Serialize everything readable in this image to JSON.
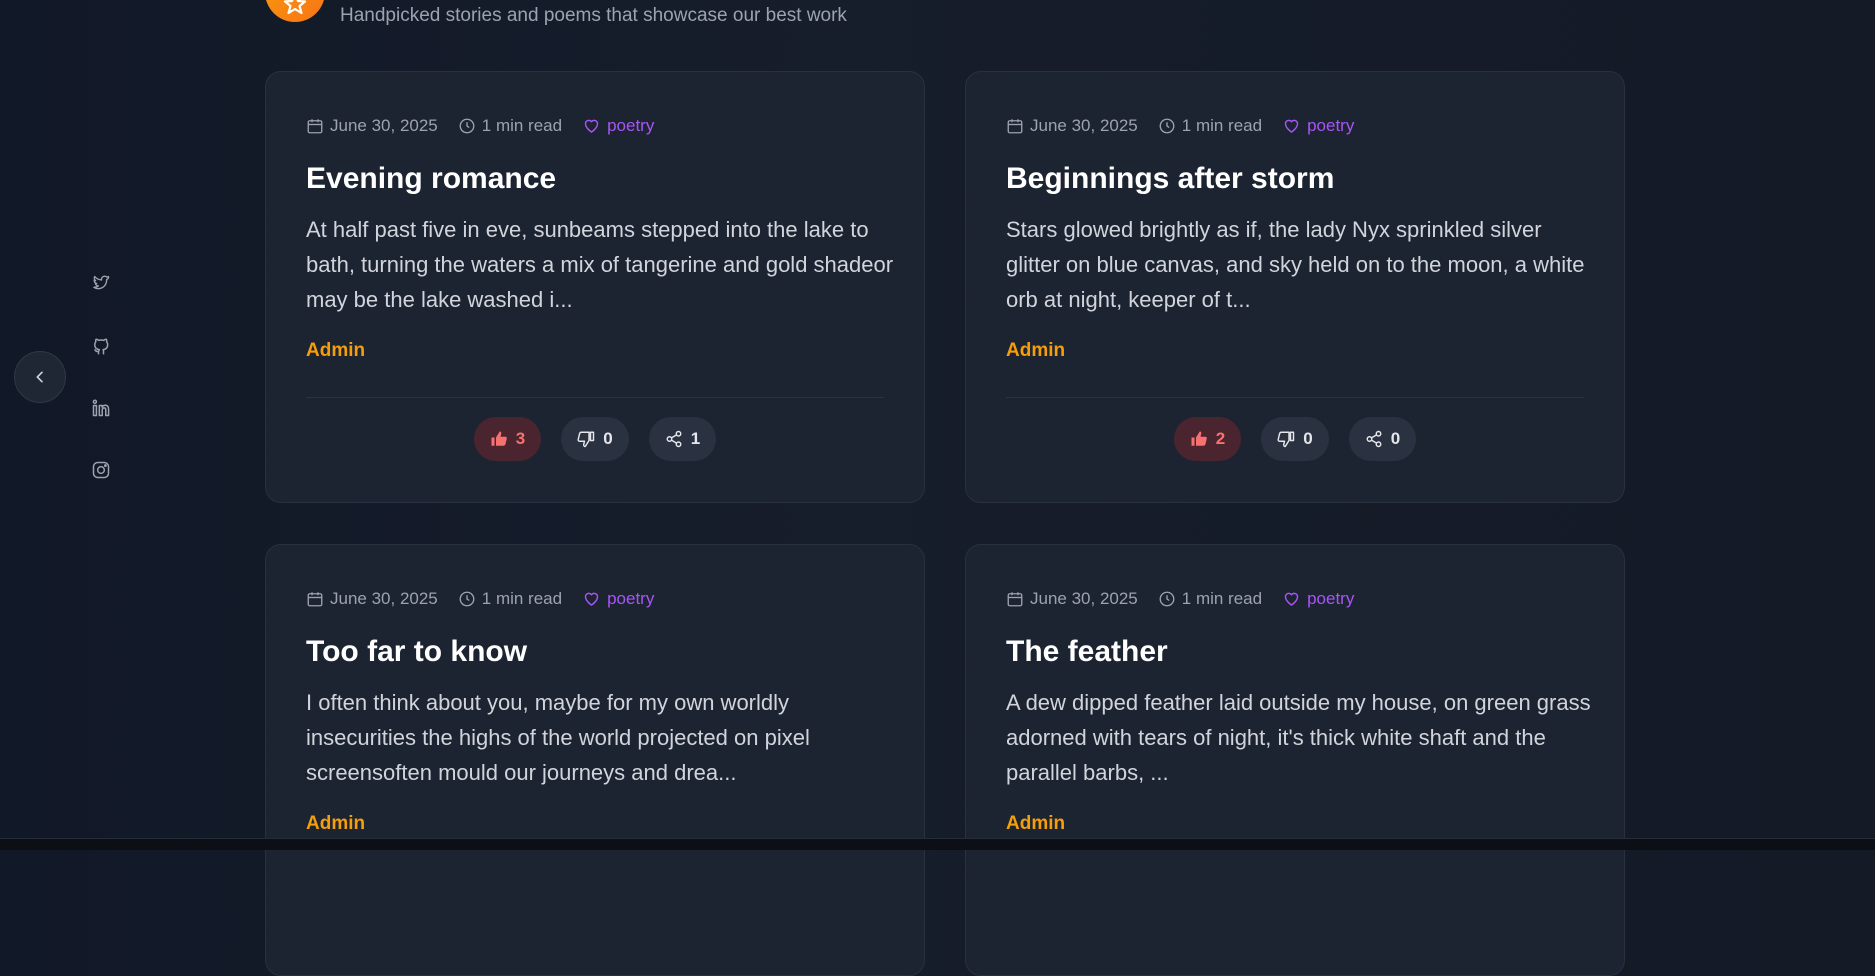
{
  "header": {
    "subtitle": "Handpicked stories and poems that showcase our best work"
  },
  "social": [
    "twitter-icon",
    "github-icon",
    "linkedin-icon",
    "instagram-icon"
  ],
  "posts": [
    {
      "date": "June 30, 2025",
      "read_time": "1 min read",
      "category": "poetry",
      "title": "Evening romance",
      "excerpt": "At half past five in eve, sunbeams stepped into the lake to bath, turning the waters a mix of tangerine and gold shadeor may be the lake washed i...",
      "author": "Admin",
      "likes": "3",
      "dislikes": "0",
      "shares": "1"
    },
    {
      "date": "June 30, 2025",
      "read_time": "1 min read",
      "category": "poetry",
      "title": "Beginnings after storm",
      "excerpt": "Stars glowed brightly as if, the lady Nyx sprinkled silver glitter on blue canvas, and sky held on to the moon, a white orb at night, keeper of t...",
      "author": "Admin",
      "likes": "2",
      "dislikes": "0",
      "shares": "0"
    },
    {
      "date": "June 30, 2025",
      "read_time": "1 min read",
      "category": "poetry",
      "title": "Too far to know",
      "excerpt": "I often think about you, maybe for my own worldly insecurities the highs of the world projected on pixel screensoften mould our journeys and drea...",
      "author": "Admin",
      "likes": "",
      "dislikes": "",
      "shares": ""
    },
    {
      "date": "June 30, 2025",
      "read_time": "1 min read",
      "category": "poetry",
      "title": "The feather",
      "excerpt": "A dew dipped feather laid outside my house, on green grass adorned with tears of night, it's thick white shaft and the parallel barbs, ...",
      "author": "Admin",
      "likes": "",
      "dislikes": "",
      "shares": ""
    }
  ]
}
